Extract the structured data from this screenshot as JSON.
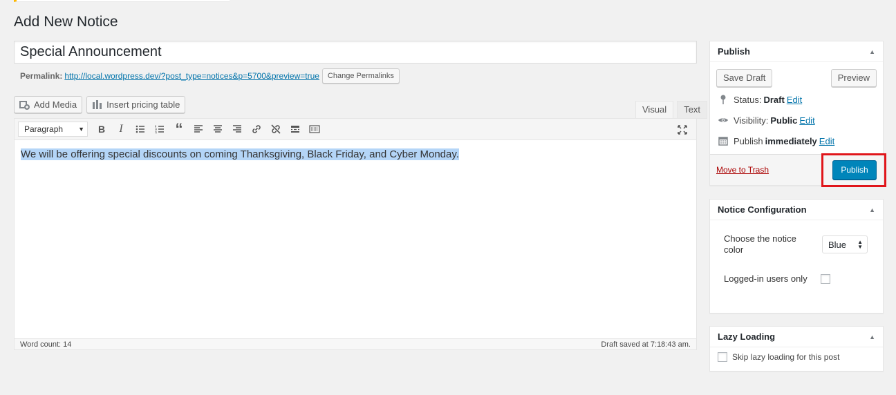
{
  "page_title": "Add New Notice",
  "post_title": "Special Announcement",
  "permalink": {
    "label": "Permalink:",
    "url": "http://local.wordpress.dev/?post_type=notices&p=5700&preview=true",
    "change_button": "Change Permalinks"
  },
  "media_buttons": {
    "add_media": "Add Media",
    "insert_pricing": "Insert pricing table"
  },
  "editor_tabs": {
    "visual": "Visual",
    "text": "Text"
  },
  "toolbar": {
    "format_value": "Paragraph",
    "icons": [
      "bold-icon",
      "italic-icon",
      "bullet-list-icon",
      "numbered-list-icon",
      "blockquote-icon",
      "align-left-icon",
      "align-center-icon",
      "align-right-icon",
      "insert-link-icon",
      "remove-link-icon",
      "read-more-icon",
      "toolbar-toggle-icon"
    ],
    "bold_glyph": "B",
    "italic_glyph": "I",
    "quote_glyph": "“"
  },
  "editor": {
    "content": "We will be offering special discounts on coming Thanksgiving, Black Friday, and Cyber Monday.",
    "word_count": "Word count: 14",
    "draft_saved": "Draft saved at 7:18:43 am."
  },
  "publish_box": {
    "title": "Publish",
    "save_draft": "Save Draft",
    "preview": "Preview",
    "status_label": "Status:",
    "status_value": "Draft",
    "visibility_label": "Visibility:",
    "visibility_value": "Public",
    "publish_label": "Publish",
    "publish_value": "immediately",
    "edit_label": "Edit",
    "move_to_trash": "Move to Trash",
    "publish_button": "Publish"
  },
  "notice_config": {
    "title": "Notice Configuration",
    "color_label": "Choose the notice color",
    "color_value": "Blue",
    "logged_in_label": "Logged-in users only",
    "logged_in_checked": false
  },
  "lazy_loading": {
    "title": "Lazy Loading",
    "skip_label": "Skip lazy loading for this post",
    "skip_checked": false
  },
  "colors": {
    "primary": "#0085ba",
    "link": "#0073aa",
    "trash": "#a00",
    "highlight": "#e0161b",
    "selection": "#b4d5f7"
  }
}
